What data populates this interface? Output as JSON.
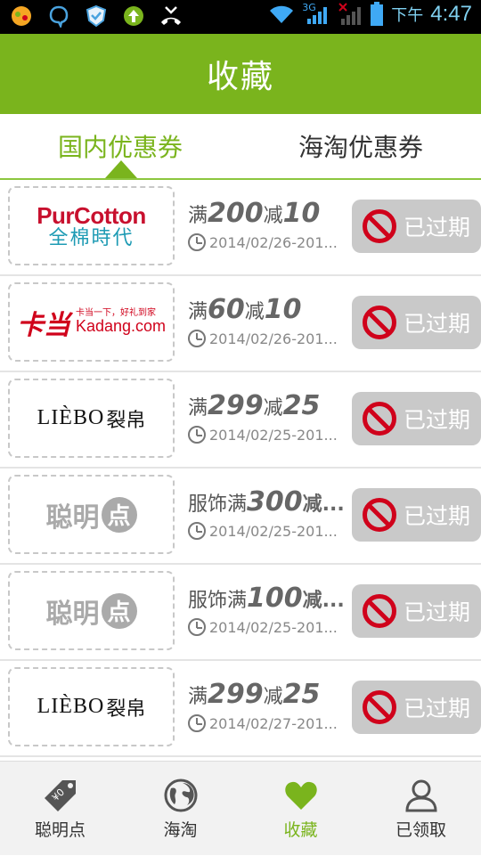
{
  "status_bar": {
    "network_label": "3G",
    "ampm": "下午",
    "time": "4:47"
  },
  "header": {
    "title": "收藏"
  },
  "tabs": {
    "domestic": "国内优惠券",
    "overseas": "海淘优惠券",
    "active": "domestic"
  },
  "coupons": [
    {
      "brand": "PurCotton 全棉时代",
      "prefix": "满",
      "amount": "200",
      "mid": "减",
      "discount": "10",
      "date": "2014/02/26-201...",
      "status": "已过期"
    },
    {
      "brand": "卡当 Kadang.com",
      "prefix": "满",
      "amount": "60",
      "mid": "减",
      "discount": "10",
      "date": "2014/02/26-201...",
      "status": "已过期"
    },
    {
      "brand": "LIEBO 裂帛",
      "prefix": "满",
      "amount": "299",
      "mid": "减",
      "discount": "25",
      "date": "2014/02/25-201...",
      "status": "已过期"
    },
    {
      "brand": "聪明点",
      "prefix": "服饰满",
      "amount": "300",
      "mid": "减...",
      "discount": "",
      "date": "2014/02/25-201...",
      "status": "已过期"
    },
    {
      "brand": "聪明点",
      "prefix": "服饰满",
      "amount": "100",
      "mid": "减...",
      "discount": "",
      "date": "2014/02/25-201...",
      "status": "已过期"
    },
    {
      "brand": "LIEBO 裂帛",
      "prefix": "满",
      "amount": "299",
      "mid": "减",
      "discount": "25",
      "date": "2014/02/27-201...",
      "status": "已过期"
    }
  ],
  "logos": {
    "purcotton_en_a": "Pur",
    "purcotton_en_b": "Cotton",
    "purcotton_cn": "全棉時代",
    "kadang_mark": "卡当",
    "kadang_slogan": "卡当一下，好礼到家",
    "kadang_domain": "Kadang.com",
    "liebo_en": "LIÈBO",
    "liebo_cn": "裂帛",
    "cmd_text": "聪明",
    "cmd_dot": "点"
  },
  "bottom_nav": [
    {
      "label": "聪明点",
      "icon": "price-tag-icon"
    },
    {
      "label": "海淘",
      "icon": "globe-icon"
    },
    {
      "label": "收藏",
      "icon": "heart-icon",
      "active": true
    },
    {
      "label": "已领取",
      "icon": "user-icon"
    }
  ],
  "colors": {
    "brand_green": "#7ab41d",
    "expired_red": "#d0021b",
    "expired_button_bg": "#c9c9c9"
  }
}
